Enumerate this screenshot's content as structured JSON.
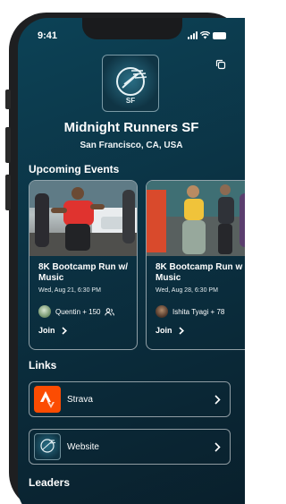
{
  "status_bar": {
    "time": "9:41"
  },
  "club": {
    "name": "Midnight Runners SF",
    "location": "San Francisco, CA, USA",
    "logo_text": "SF"
  },
  "sections": {
    "events_title": "Upcoming Events",
    "links_title": "Links",
    "leaders_title": "Leaders"
  },
  "events": [
    {
      "title_line1": "8K Bootcamp Run w/",
      "title_line2": "Music",
      "date": "Wed, Aug 21, 6:30 PM",
      "attendees": "Quentin + 150",
      "join_label": "Join"
    },
    {
      "title_line1": "8K Bootcamp Run w",
      "title_line2": "Music",
      "date": "Wed, Aug 28, 6:30 PM",
      "attendees": "Ishita Tyagi + 78",
      "join_label": "Join"
    }
  ],
  "links": [
    {
      "label": "Strava",
      "icon": "strava-icon",
      "color": "#fc4c02"
    },
    {
      "label": "Website",
      "icon": "club-logo-icon",
      "color": "#0f3444"
    }
  ],
  "colors": {
    "background_top": "#0c4256",
    "background_bottom": "#091f2b",
    "strava": "#fc4c02"
  }
}
